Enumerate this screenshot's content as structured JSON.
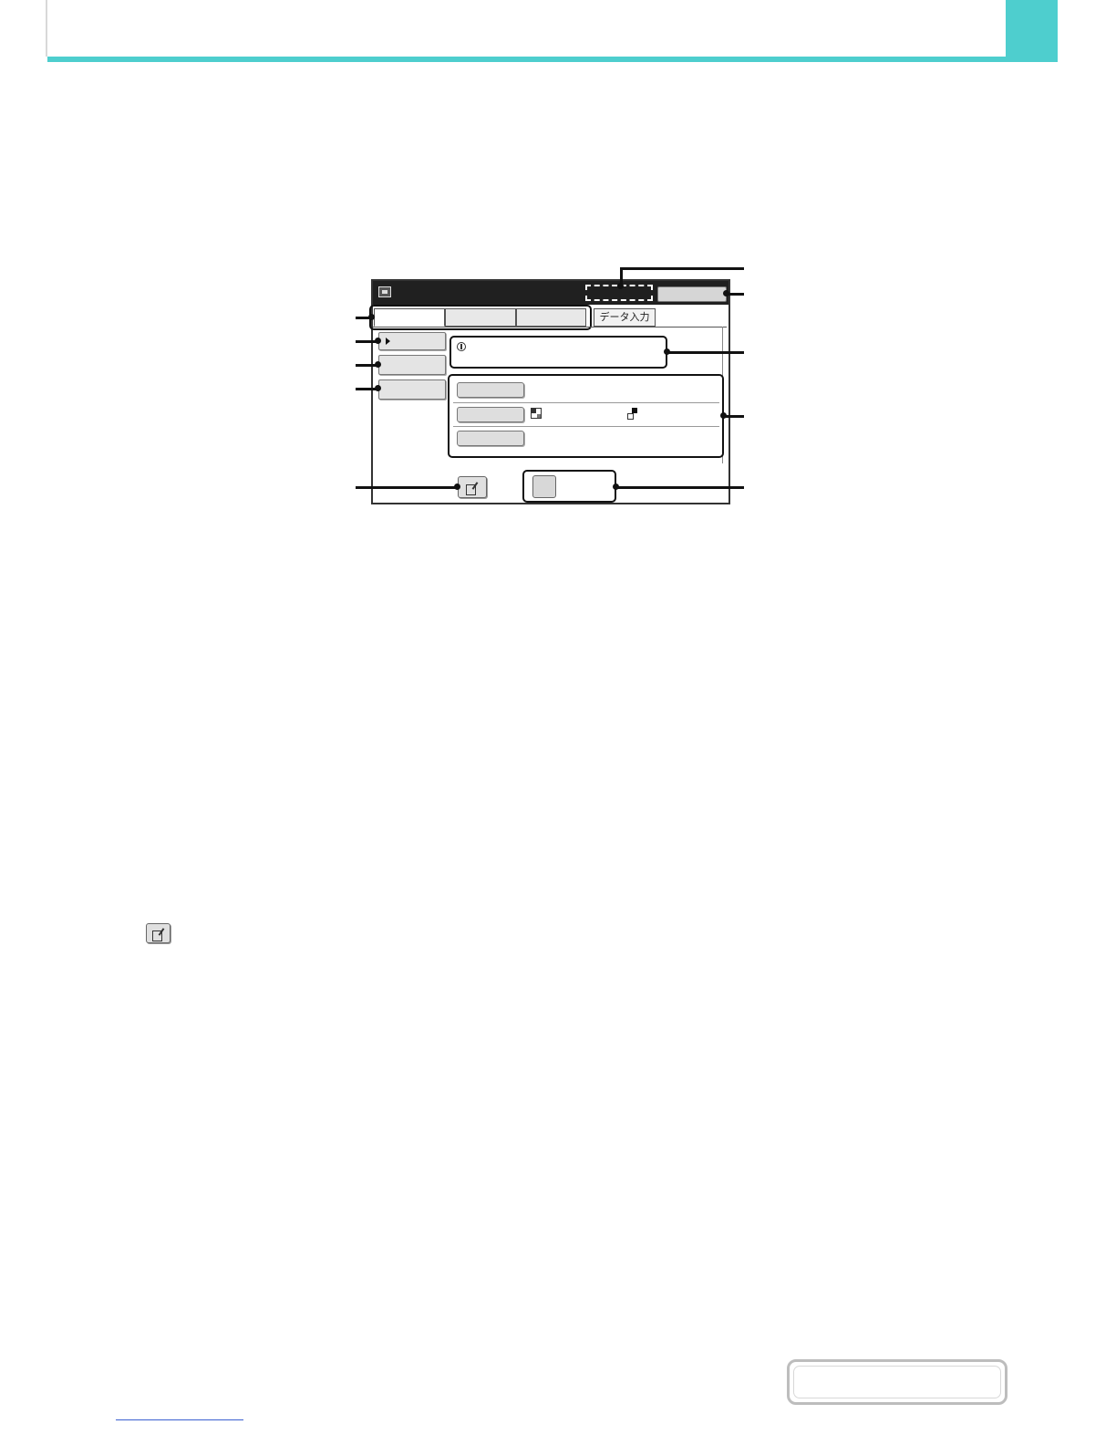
{
  "screen": {
    "tabs": [
      {
        "label": ""
      },
      {
        "label": ""
      },
      {
        "label": ""
      },
      {
        "label": "データ入力"
      }
    ]
  },
  "icons": {
    "title": "screen-mode-icon",
    "message": "info-icon",
    "pen": "edit-icon",
    "pattern_a": "checker-pattern-icon",
    "pattern_b": "corner-pattern-icon"
  },
  "colors": {
    "accent": "#4ecece",
    "title_bar": "#202020",
    "callout": "#111111",
    "link": "#3a5fd0"
  }
}
